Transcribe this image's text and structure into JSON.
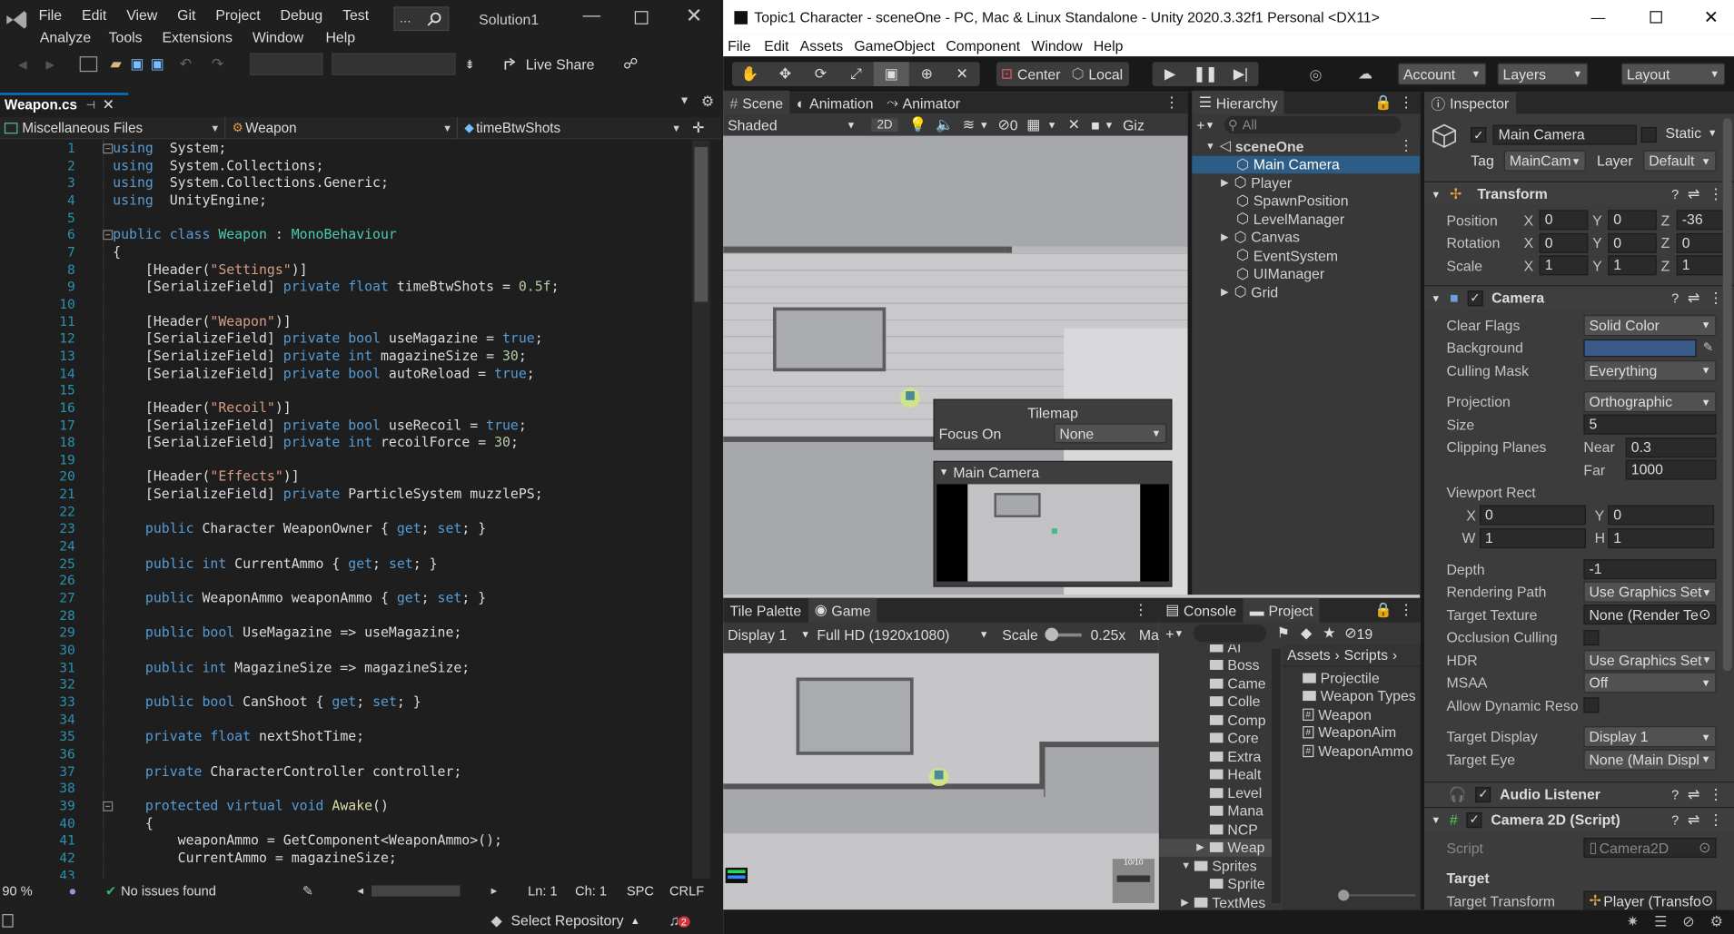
{
  "vs": {
    "menu1": [
      "File",
      "Edit",
      "View",
      "Git",
      "Project",
      "Debug",
      "Test"
    ],
    "menu2": [
      "Analyze",
      "Tools",
      "Extensions",
      "Window",
      "Help"
    ],
    "search_glyph": "…",
    "solution": "Solution1",
    "live_share": "Live Share",
    "doc_tab": "Weapon.cs",
    "nav_files": "Miscellaneous Files",
    "nav_class": "Weapon",
    "nav_member": "timeBtwShots",
    "zoom": "90 %",
    "issues": "No issues found",
    "ln": "Ln: 1",
    "ch": "Ch: 1",
    "spc": "SPC",
    "crlf": "CRLF",
    "select_repo": "Select Repository",
    "notif_count": "2",
    "code": [
      [
        [
          "kw",
          "using"
        ],
        [
          "",
          "  System;"
        ]
      ],
      [
        [
          "kw",
          "using"
        ],
        [
          "",
          "  System.Collections;"
        ]
      ],
      [
        [
          "kw",
          "using"
        ],
        [
          "",
          "  System.Collections.Generic;"
        ]
      ],
      [
        [
          "kw",
          "using"
        ],
        [
          "",
          "  UnityEngine;"
        ]
      ],
      [],
      [
        [
          "kw",
          "public class "
        ],
        [
          "ty",
          "Weapon"
        ],
        [
          "",
          " : "
        ],
        [
          "ty",
          "MonoBehaviour"
        ]
      ],
      [
        [
          "",
          "{"
        ]
      ],
      [
        [
          "",
          "    [Header("
        ],
        [
          "st",
          "\"Settings\""
        ],
        [
          "",
          ")]"
        ]
      ],
      [
        [
          "",
          "    [SerializeField] "
        ],
        [
          "kw",
          "private float "
        ],
        [
          "",
          "timeBtwShots = "
        ],
        [
          "nm",
          "0.5f"
        ],
        [
          "",
          ";"
        ]
      ],
      [],
      [
        [
          "",
          "    [Header("
        ],
        [
          "st",
          "\"Weapon\""
        ],
        [
          "",
          ")]"
        ]
      ],
      [
        [
          "",
          "    [SerializeField] "
        ],
        [
          "kw",
          "private bool "
        ],
        [
          "",
          "useMagazine = "
        ],
        [
          "kw",
          "true"
        ],
        [
          "",
          ";"
        ]
      ],
      [
        [
          "",
          "    [SerializeField] "
        ],
        [
          "kw",
          "private int "
        ],
        [
          "",
          "magazineSize = "
        ],
        [
          "nm",
          "30"
        ],
        [
          "",
          ";"
        ]
      ],
      [
        [
          "",
          "    [SerializeField] "
        ],
        [
          "kw",
          "private bool "
        ],
        [
          "",
          "autoReload = "
        ],
        [
          "kw",
          "true"
        ],
        [
          "",
          ";"
        ]
      ],
      [],
      [
        [
          "",
          "    [Header("
        ],
        [
          "st",
          "\"Recoil\""
        ],
        [
          "",
          ")]"
        ]
      ],
      [
        [
          "",
          "    [SerializeField] "
        ],
        [
          "kw",
          "private bool "
        ],
        [
          "",
          "useRecoil = "
        ],
        [
          "kw",
          "true"
        ],
        [
          "",
          ";"
        ]
      ],
      [
        [
          "",
          "    [SerializeField] "
        ],
        [
          "kw",
          "private int "
        ],
        [
          "",
          "recoilForce = "
        ],
        [
          "nm",
          "30"
        ],
        [
          "",
          ";"
        ]
      ],
      [],
      [
        [
          "",
          "    [Header("
        ],
        [
          "st",
          "\"Effects\""
        ],
        [
          "",
          ")]"
        ]
      ],
      [
        [
          "",
          "    [SerializeField] "
        ],
        [
          "kw",
          "private "
        ],
        [
          "",
          "ParticleSystem muzzlePS;"
        ]
      ],
      [],
      [
        [
          "kw",
          "    public "
        ],
        [
          "",
          "Character WeaponOwner { "
        ],
        [
          "kw",
          "get"
        ],
        [
          "",
          "; "
        ],
        [
          "kw",
          "set"
        ],
        [
          "",
          "; }"
        ]
      ],
      [],
      [
        [
          "kw",
          "    public int "
        ],
        [
          "",
          "CurrentAmmo { "
        ],
        [
          "kw",
          "get"
        ],
        [
          "",
          "; "
        ],
        [
          "kw",
          "set"
        ],
        [
          "",
          "; }"
        ]
      ],
      [],
      [
        [
          "kw",
          "    public "
        ],
        [
          "",
          "WeaponAmmo weaponAmmo { "
        ],
        [
          "kw",
          "get"
        ],
        [
          "",
          "; "
        ],
        [
          "kw",
          "set"
        ],
        [
          "",
          "; }"
        ]
      ],
      [],
      [
        [
          "kw",
          "    public bool "
        ],
        [
          "",
          "UseMagazine => useMagazine;"
        ]
      ],
      [],
      [
        [
          "kw",
          "    public int "
        ],
        [
          "",
          "MagazineSize => magazineSize;"
        ]
      ],
      [],
      [
        [
          "kw",
          "    public bool "
        ],
        [
          "",
          "CanShoot { "
        ],
        [
          "kw",
          "get"
        ],
        [
          "",
          "; "
        ],
        [
          "kw",
          "set"
        ],
        [
          "",
          "; }"
        ]
      ],
      [],
      [
        [
          "kw",
          "    private float "
        ],
        [
          "",
          "nextShotTime;"
        ]
      ],
      [],
      [
        [
          "kw",
          "    private "
        ],
        [
          "",
          "CharacterController controller;"
        ]
      ],
      [],
      [
        [
          "kw",
          "    protected virtual void "
        ],
        [
          "me",
          "Awake"
        ],
        [
          "",
          "()"
        ]
      ],
      [
        [
          "",
          "    {"
        ]
      ],
      [
        [
          "",
          "        weaponAmmo = GetComponent<WeaponAmmo>();"
        ]
      ],
      [
        [
          "",
          "        CurrentAmmo = magazineSize;"
        ]
      ],
      [
        [
          "",
          ""
        ]
      ]
    ]
  },
  "unity": {
    "title": "Topic1 Character - sceneOne - PC, Mac & Linux Standalone - Unity 2020.3.32f1 Personal <DX11>",
    "menu": [
      "File",
      "Edit",
      "Assets",
      "GameObject",
      "Component",
      "Window",
      "Help"
    ],
    "center": "Center",
    "local": "Local",
    "account": "Account",
    "layers": "Layers",
    "layout": "Layout",
    "scene_tabs": [
      "Scene",
      "Animation",
      "Animator"
    ],
    "shaded": "Shaded",
    "btn2d": "2D",
    "hidden_count": "0",
    "giz": "Giz",
    "hierarchy": "Hierarchy",
    "search_all": "All",
    "scene_name": "sceneOne",
    "h_items": [
      "Main Camera",
      "Player",
      "SpawnPosition",
      "LevelManager",
      "Canvas",
      "EventSystem",
      "UIManager",
      "Grid"
    ],
    "tilemap": {
      "title": "Tilemap",
      "focus_label": "Focus On",
      "focus_value": "None"
    },
    "cam_preview": "Main Camera",
    "game_tabs": [
      "Tile Palette",
      "Game"
    ],
    "display": "Display 1",
    "res": "Full HD (1920x1080)",
    "scale_label": "Scale",
    "scale_val": "0.25x",
    "ma": "Ma",
    "console": "Console",
    "project": "Project",
    "badge19": "19",
    "proj_tree": [
      "AI",
      "Boss",
      "Came",
      "Colle",
      "Comp",
      "Core",
      "Extra",
      "Healt",
      "Level",
      "Mana",
      "NCP",
      "Weap",
      "Sprites",
      "Sprite",
      "TextMes"
    ],
    "crumb": [
      "Assets",
      "Scripts"
    ],
    "proj_files": [
      "Projectile",
      "Weapon Types",
      "Weapon",
      "WeaponAim",
      "WeaponAmmo"
    ],
    "hud_ammo": "10/10",
    "inspector": "Inspector",
    "obj_name": "Main Camera",
    "static": "Static",
    "tag_label": "Tag",
    "tag": "MainCam",
    "layer_label": "Layer",
    "layer": "Default",
    "transform": "Transform",
    "tf": [
      [
        "Position",
        "0",
        "0",
        "-36"
      ],
      [
        "Rotation",
        "0",
        "0",
        "0"
      ],
      [
        "Scale",
        "1",
        "1",
        "1"
      ]
    ],
    "camera": "Camera",
    "cam_rows": [
      [
        "Clear Flags",
        "Solid Color"
      ],
      [
        "Background",
        ""
      ],
      [
        "Culling Mask",
        "Everything"
      ]
    ],
    "projection": [
      "Projection",
      "Orthographic"
    ],
    "size": [
      "Size",
      "5"
    ],
    "clip": [
      "Clipping Planes",
      "Near",
      "0.3",
      "Far",
      "1000"
    ],
    "vp": "Viewport Rect",
    "vpv": [
      "X",
      "0",
      "Y",
      "0",
      "W",
      "1",
      "H",
      "1"
    ],
    "depth": [
      "Depth",
      "-1"
    ],
    "rpath": [
      "Rendering Path",
      "Use Graphics Set"
    ],
    "ttex": [
      "Target Texture",
      "None (Render Te"
    ],
    "occ": "Occlusion Culling",
    "hdr": [
      "HDR",
      "Use Graphics Set"
    ],
    "msaa": [
      "MSAA",
      "Off"
    ],
    "adr": "Allow Dynamic Reso",
    "tdisp": [
      "Target Display",
      "Display 1"
    ],
    "teye": [
      "Target Eye",
      "None (Main Displ"
    ],
    "audio": "Audio Listener",
    "cam2d": "Camera 2D (Script)",
    "script": [
      "Script",
      "Camera2D"
    ],
    "target": "Target",
    "ttr": [
      "Target Transform",
      "Player (Transfo"
    ],
    "bg_color": "#3a5a8a"
  }
}
